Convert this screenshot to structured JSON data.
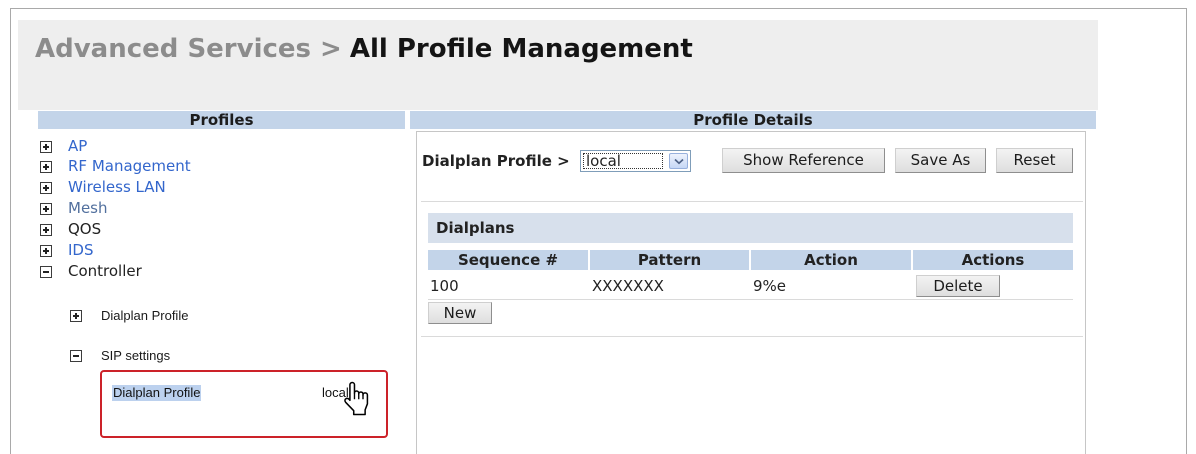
{
  "window": {
    "breadcrumb": "Advanced Services >",
    "title": "All Profile Management"
  },
  "profiles": {
    "header": "Profiles",
    "tree": [
      {
        "label": "AP",
        "icon": "plus-box-icon",
        "color": "#3366cc"
      },
      {
        "label": "RF Management",
        "icon": "plus-box-icon",
        "color": "#3366cc"
      },
      {
        "label": "Wireless LAN",
        "icon": "plus-box-icon",
        "color": "#3366cc"
      },
      {
        "label": "Mesh",
        "icon": "plus-box-icon",
        "color": "#52709e"
      },
      {
        "label": "QOS",
        "icon": "plus-box-icon",
        "color": "#222222"
      },
      {
        "label": "IDS",
        "icon": "plus-box-icon",
        "color": "#3366cc"
      },
      {
        "label": "Controller",
        "icon": "minus-box-icon",
        "color": "#222222"
      }
    ],
    "controller_children": [
      {
        "label": "Dialplan Profile",
        "icon": "plus-box-icon"
      },
      {
        "label": "SIP settings",
        "icon": "minus-box-icon"
      }
    ],
    "sip_settings_entry": {
      "label": "Dialplan Profile",
      "value": "local",
      "cursor_icon": "hand-pointer-icon"
    }
  },
  "details": {
    "header": "Profile Details",
    "profile_label": "Dialplan Profile >",
    "profile_select": {
      "selected": "local",
      "arrow_icon": "chevron-down-icon"
    },
    "buttons": {
      "show_reference": "Show Reference",
      "save_as": "Save As",
      "reset": "Reset"
    },
    "dialplans": {
      "title": "Dialplans",
      "columns": [
        "Sequence #",
        "Pattern",
        "Action",
        "Actions"
      ],
      "rows": [
        {
          "sequence": "100",
          "pattern": "XXXXXXX",
          "action": "9%e",
          "delete_label": "Delete"
        }
      ],
      "new_label": "New"
    }
  },
  "colors": {
    "header_bar": "#c3d4e9",
    "section_bar": "#d7e0ec",
    "highlight_box": "#cc2229",
    "selection": "#bcd1ee"
  }
}
